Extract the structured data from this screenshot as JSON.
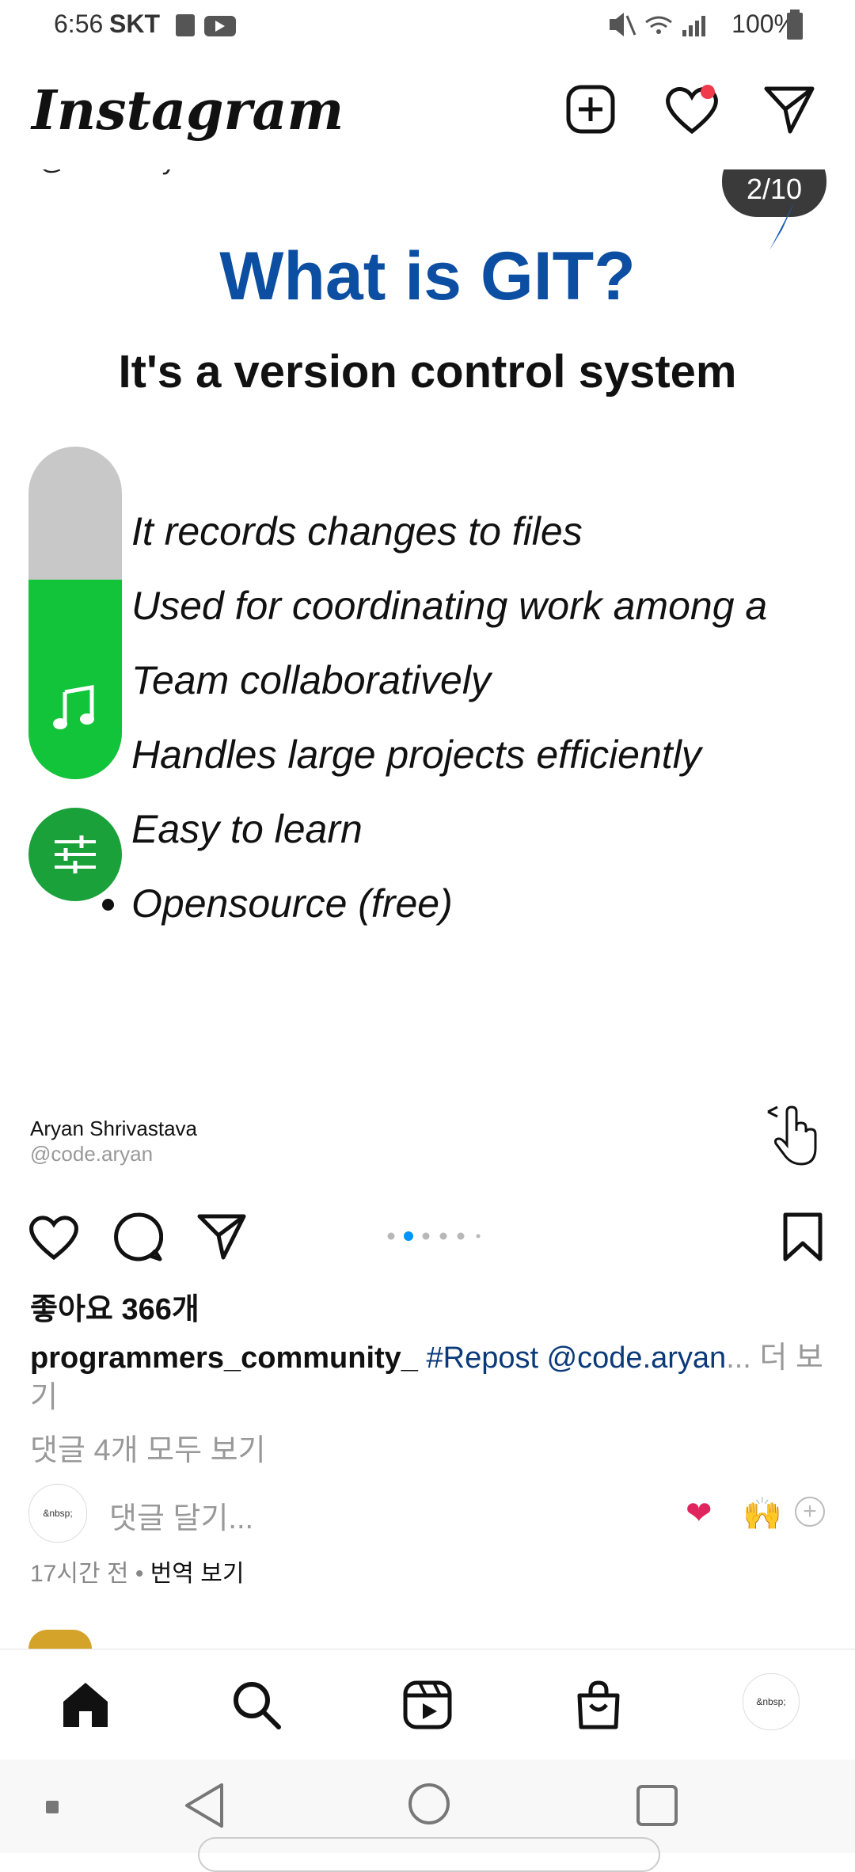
{
  "status_bar": {
    "time": "6:56",
    "carrier": "SKT",
    "battery": "100%"
  },
  "header": {
    "logo": "Instagram"
  },
  "slide": {
    "handle_top": "@code.aryan",
    "counter": "2/10",
    "title": "What is GIT?",
    "subtitle": "It's a version control system",
    "bullets": [
      "It records changes to files",
      "Used for coordinating work among a",
      "Team collaboratively",
      "Handles large projects efficiently",
      "Easy to learn",
      "Opensource (free)"
    ],
    "author_name": "Aryan Shrivastava",
    "author_handle": "@code.aryan"
  },
  "post": {
    "likes": "좋아요 366개",
    "username": "programmers_community_",
    "caption_tag": "#Repost @code.aryan",
    "caption_ellipsis": "...",
    "more": " 더 보기",
    "view_comments": "댓글 4개 모두 보기",
    "comment_placeholder": "댓글 달기...",
    "avatar_text": "&nbsp;",
    "time_ago": "17시간 전",
    "separator": " • ",
    "translate": "번역 보기",
    "reactions": [
      "❤",
      "🙌",
      "+"
    ],
    "carousel": {
      "count": 6,
      "active": 1
    }
  },
  "bottom_nav": {
    "profile_text": "&nbsp;"
  },
  "colors": {
    "title_blue": "#0b4ea2",
    "music_green": "#12c43a",
    "hashtag": "#0b3a7a",
    "notification_dot": "#ef3b4c"
  },
  "icons": [
    "home-icon",
    "search-icon",
    "reels-icon",
    "shop-icon",
    "heart-icon",
    "send-icon",
    "new-post-icon",
    "comment-icon",
    "bookmark-icon"
  ]
}
